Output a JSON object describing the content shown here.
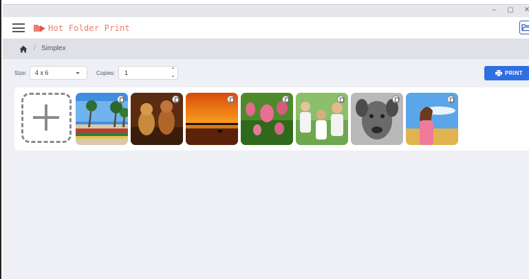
{
  "window": {
    "minimize": "–",
    "maximize": "▢",
    "close": "✕"
  },
  "header": {
    "app_title": "Hot Folder Print"
  },
  "breadcrumb": {
    "current": "Simplex",
    "separator": "/"
  },
  "toolbar": {
    "size_label": "Size:",
    "size_value": "4 x 6",
    "copies_label": "Copies:",
    "copies_value": "1",
    "print_label": "PRINT"
  },
  "gallery": {
    "images": [
      {
        "subject": "beach-boats"
      },
      {
        "subject": "two-dogs"
      },
      {
        "subject": "sunset"
      },
      {
        "subject": "tulips"
      },
      {
        "subject": "children"
      },
      {
        "subject": "dog-bw"
      },
      {
        "subject": "girl-field"
      }
    ]
  },
  "colors": {
    "accent": "#2f6fe0",
    "brand": "#f07b6f",
    "strip": "#dfe1e6",
    "main_bg": "#eef0f6"
  }
}
